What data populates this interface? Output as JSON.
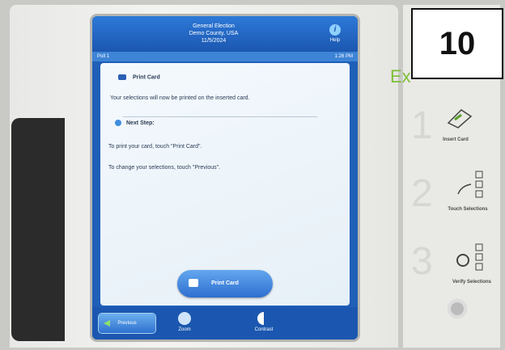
{
  "header": {
    "line1": "General Election",
    "line2": "Demo County, USA",
    "line3": "11/5/2024",
    "help_label": "Help",
    "help_icon": "info-icon"
  },
  "status": {
    "poll": "Poll 1",
    "time": "1:26 PM"
  },
  "content": {
    "title": "Print Card",
    "message": "Your selections will now be printed on the inserted card.",
    "next_step_title": "Next Step:",
    "instr1": "To print your card, touch \"Print Card\".",
    "instr2": "To change your selections, touch \"Previous\"."
  },
  "buttons": {
    "print_card": "Print Card",
    "previous": "Previous",
    "zoom": "Zoom",
    "contrast": "Contrast"
  },
  "side": {
    "badge": "10",
    "ex_text": "Ex",
    "steps": [
      {
        "num": "1",
        "label": "Insert Card"
      },
      {
        "num": "2",
        "label": "Touch Selections"
      },
      {
        "num": "3",
        "label": "Verify Selections"
      }
    ]
  }
}
